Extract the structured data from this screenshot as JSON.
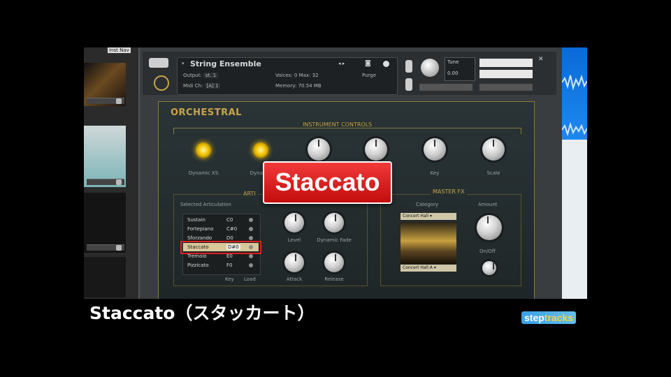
{
  "host": {
    "top_label": "Inst Nav"
  },
  "kontakt": {
    "instrument_name": "String Ensemble",
    "output_label": "Output:",
    "output_value": "st. 1",
    "midi_label": "Midi Ch:",
    "midi_value": "[A] 1",
    "voices_label": "Voices:",
    "voices_value": "0",
    "max_label": "Max:",
    "max_value": "32",
    "memory_label": "Memory:",
    "memory_value": "70.54 MB",
    "purge_label": "Purge",
    "tune_label": "Tune",
    "tune_value": "0.00"
  },
  "panel": {
    "title": "ORCHESTRAL",
    "instrument_controls_title": "INSTRUMENT CONTROLS",
    "controls": [
      "Dynamic XS",
      "Dynamic",
      "",
      "",
      "Key",
      "Scale"
    ],
    "articulation_section_title": "ARTI",
    "selected_articulation_label": "Selected Articulation",
    "articulations": [
      {
        "name": "Sustain",
        "key": "C0"
      },
      {
        "name": "Fortepiano",
        "key": "C#0"
      },
      {
        "name": "Sforzando",
        "key": "D0"
      },
      {
        "name": "Staccato",
        "key": "D#0"
      },
      {
        "name": "Tremolo",
        "key": "E0"
      },
      {
        "name": "Pizzicato",
        "key": "F0"
      }
    ],
    "list_footer_key": "Key",
    "list_footer_load": "Load",
    "art_knobs": [
      "Level",
      "Dynamic Fade",
      "Attack",
      "Release"
    ],
    "master_fx_title": "MASTER FX",
    "category_label": "Category",
    "category_value": "Concert Hall",
    "preset_value": "Concert Hall A",
    "amount_label": "Amount",
    "onoff_label": "On/Off"
  },
  "badge": {
    "text": "Staccato"
  },
  "caption": {
    "text": "Staccato（スタッカート）"
  },
  "logo": {
    "text_a": "step",
    "text_b": "tracks"
  },
  "colors": {
    "accent_gold": "#c9a44a",
    "badge_red": "#e02020"
  }
}
